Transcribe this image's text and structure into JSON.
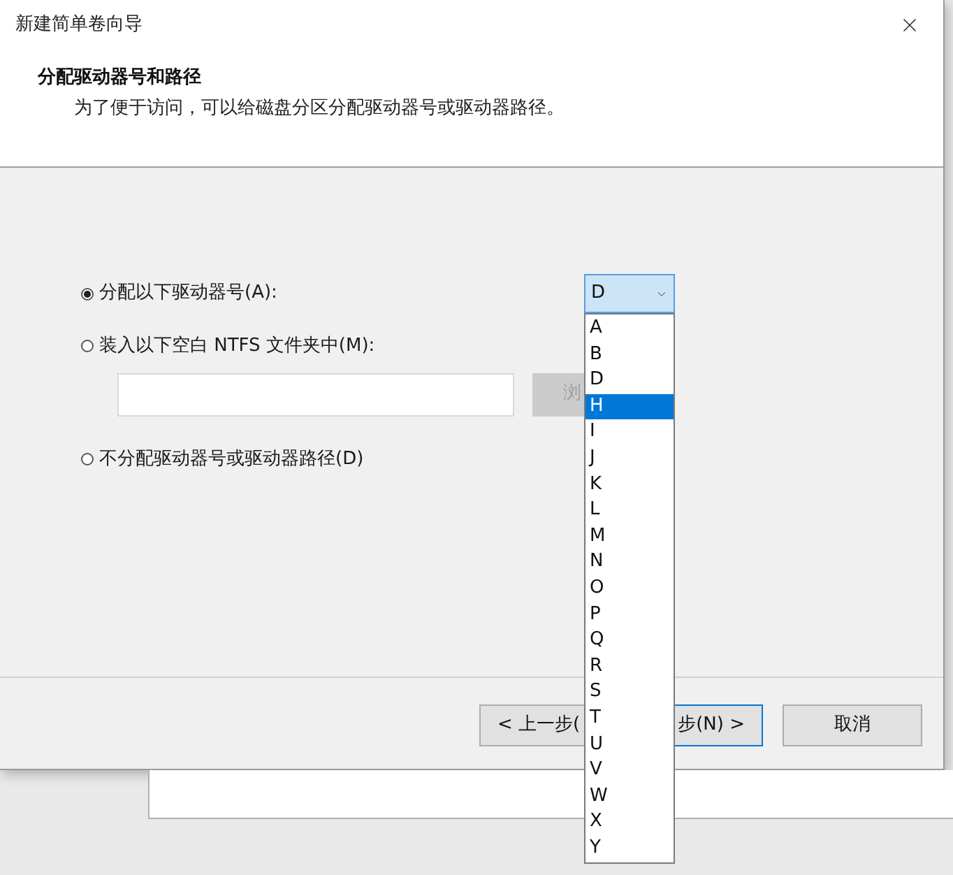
{
  "window": {
    "title": "新建简单卷向导"
  },
  "header": {
    "title": "分配驱动器号和路径",
    "subtitle": "为了便于访问，可以给磁盘分区分配驱动器号或驱动器路径。"
  },
  "options": [
    {
      "label": "分配以下驱动器号(A):",
      "selected": true
    },
    {
      "label": "装入以下空白 NTFS 文件夹中(M):",
      "selected": false
    },
    {
      "label": "不分配驱动器号或驱动器路径(D)",
      "selected": false
    }
  ],
  "drive_letter": {
    "value": "D",
    "expanded": true,
    "options": [
      {
        "label": "A",
        "highlighted": false
      },
      {
        "label": "B",
        "highlighted": false
      },
      {
        "label": "D",
        "highlighted": false
      },
      {
        "label": "H",
        "highlighted": true
      },
      {
        "label": "I",
        "highlighted": false
      },
      {
        "label": "J",
        "highlighted": false
      },
      {
        "label": "K",
        "highlighted": false
      },
      {
        "label": "L",
        "highlighted": false
      },
      {
        "label": "M",
        "highlighted": false
      },
      {
        "label": "N",
        "highlighted": false
      },
      {
        "label": "O",
        "highlighted": false
      },
      {
        "label": "P",
        "highlighted": false
      },
      {
        "label": "Q",
        "highlighted": false
      },
      {
        "label": "R",
        "highlighted": false
      },
      {
        "label": "S",
        "highlighted": false
      },
      {
        "label": "T",
        "highlighted": false
      },
      {
        "label": "U",
        "highlighted": false
      },
      {
        "label": "V",
        "highlighted": false
      },
      {
        "label": "W",
        "highlighted": false
      },
      {
        "label": "X",
        "highlighted": false
      },
      {
        "label": "Y",
        "highlighted": false
      }
    ]
  },
  "browse_button": {
    "label": "浏",
    "disabled": true
  },
  "buttons": [
    {
      "label": "< 上一步(",
      "kind": "back"
    },
    {
      "label": "步(N) >",
      "kind": "next"
    },
    {
      "label": "取消",
      "kind": "cancel"
    }
  ]
}
